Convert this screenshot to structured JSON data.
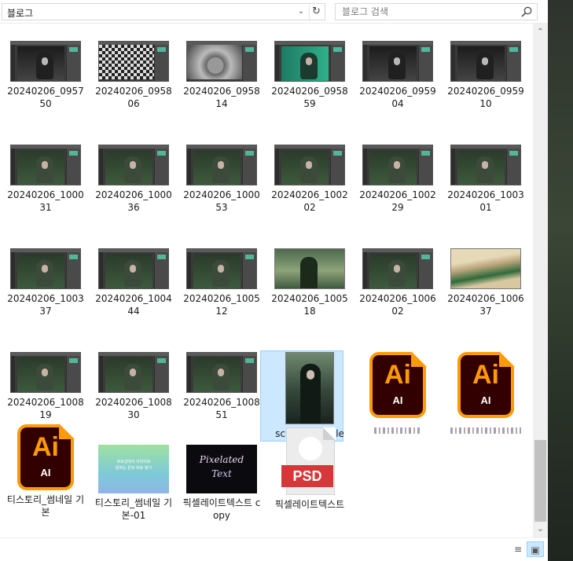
{
  "address": {
    "path": "블로그",
    "dropdown_icon": "chevron-down-icon",
    "refresh_icon": "refresh-icon"
  },
  "search": {
    "placeholder": "블로그 검색",
    "icon": "search-icon"
  },
  "files": [
    {
      "name": "20240206_095750",
      "kind": "screenshot-bw"
    },
    {
      "name": "20240206_095806",
      "kind": "screenshot-checker"
    },
    {
      "name": "20240206_095814",
      "kind": "screenshot-closeup"
    },
    {
      "name": "20240206_095859",
      "kind": "screenshot-teal"
    },
    {
      "name": "20240206_095904",
      "kind": "screenshot-bw"
    },
    {
      "name": "20240206_095910",
      "kind": "screenshot-bw"
    },
    {
      "name": "20240206_100031",
      "kind": "screenshot-ps"
    },
    {
      "name": "20240206_100036",
      "kind": "screenshot-ps"
    },
    {
      "name": "20240206_100053",
      "kind": "screenshot-ps"
    },
    {
      "name": "20240206_100202",
      "kind": "screenshot-ps"
    },
    {
      "name": "20240206_100229",
      "kind": "screenshot-ps"
    },
    {
      "name": "20240206_100301",
      "kind": "screenshot-ps"
    },
    {
      "name": "20240206_100337",
      "kind": "screenshot-ps"
    },
    {
      "name": "20240206_100444",
      "kind": "screenshot-ps"
    },
    {
      "name": "20240206_100512",
      "kind": "screenshot-ps"
    },
    {
      "name": "20240206_100518",
      "kind": "photo-green"
    },
    {
      "name": "20240206_100602",
      "kind": "screenshot-ps"
    },
    {
      "name": "20240206_100637",
      "kind": "photo-pixel"
    },
    {
      "name": "20240206_100819",
      "kind": "screenshot-ps"
    },
    {
      "name": "20240206_100830",
      "kind": "screenshot-ps"
    },
    {
      "name": "20240206_100851",
      "kind": "screenshot-ps"
    },
    {
      "name": "screen-sample",
      "kind": "photo-portrait",
      "selected": true
    },
    {
      "name": "",
      "kind": "ai",
      "badge_big": "Ai",
      "badge_small": "AI",
      "obscured": true
    },
    {
      "name": "",
      "kind": "ai",
      "badge_big": "Ai",
      "badge_small": "AI",
      "obscured": true
    },
    {
      "name": "티스토리_썸네일 기본",
      "kind": "ai",
      "badge_big": "Ai",
      "badge_small": "AI"
    },
    {
      "name": "티스토리_썸네일 기본-01",
      "kind": "banner"
    },
    {
      "name": "픽셀레이트텍스트 copy",
      "kind": "pixelated"
    },
    {
      "name": "픽셀레이트텍스트",
      "kind": "psd",
      "badge": "PSD"
    }
  ],
  "thumbnail_text": {
    "banner_line1": "포토샵에서 이미지로",
    "banner_line2": "원하는 폰트 바로 찾기",
    "pixelated_line1": "Pixelated",
    "pixelated_line2": "Text"
  },
  "view_buttons": {
    "details_icon": "details-view-icon",
    "large_icon": "large-icons-view-icon"
  },
  "colors": {
    "selection": "#cce8ff",
    "ai_orange": "#ff9a00",
    "ai_bg": "#330000",
    "psd_red": "#d6383a"
  }
}
